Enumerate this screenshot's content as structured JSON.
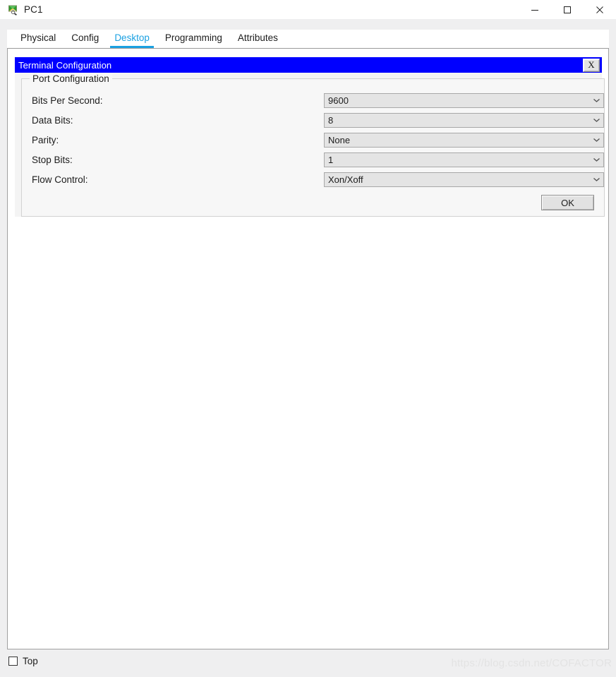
{
  "window": {
    "title": "PC1",
    "icon": "pc-device-icon",
    "controls": [
      {
        "name": "minimize-button",
        "glyph": "minimize-icon"
      },
      {
        "name": "maximize-button",
        "glyph": "maximize-icon"
      },
      {
        "name": "close-button",
        "glyph": "close-icon"
      }
    ]
  },
  "tabs": [
    {
      "label": "Physical",
      "active": false
    },
    {
      "label": "Config",
      "active": false
    },
    {
      "label": "Desktop",
      "active": true
    },
    {
      "label": "Programming",
      "active": false
    },
    {
      "label": "Attributes",
      "active": false
    }
  ],
  "dialog": {
    "title": "Terminal Configuration",
    "close_label": "X",
    "fieldset_legend": "Port Configuration",
    "fields": [
      {
        "label": "Bits Per Second:",
        "value": "9600",
        "name": "bits-per-second"
      },
      {
        "label": "Data Bits:",
        "value": "8",
        "name": "data-bits"
      },
      {
        "label": "Parity:",
        "value": "None",
        "name": "parity"
      },
      {
        "label": "Stop Bits:",
        "value": "1",
        "name": "stop-bits"
      },
      {
        "label": "Flow Control:",
        "value": "Xon/Xoff",
        "name": "flow-control"
      }
    ],
    "ok_label": "OK"
  },
  "footer": {
    "top_checkbox_label": "Top",
    "top_checkbox_checked": false,
    "watermark": "https://blog.csdn.net/COFACTOR"
  },
  "colors": {
    "accent_tab": "#1BA1E2",
    "dialog_titlebar": "#0000FF",
    "dialog_titlebar_text": "#FFFFFF",
    "panel_background": "#FFFFFF",
    "chrome_background": "#EFEFF0",
    "combobox_background": "#E4E4E4"
  }
}
